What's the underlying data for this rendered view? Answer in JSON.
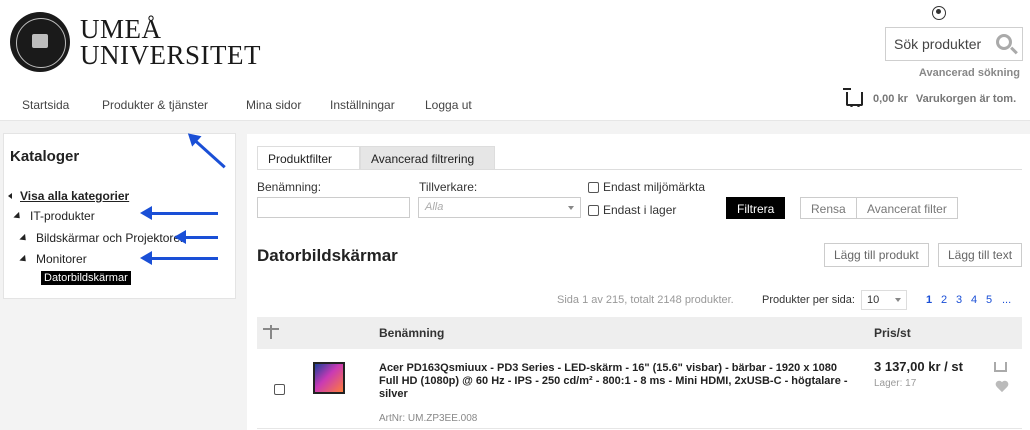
{
  "header": {
    "logo_line1": "UMEÅ",
    "logo_line2": "UNIVERSITET",
    "search_placeholder": "Sök produkter",
    "advanced_search": "Avancerad sökning",
    "cart_total": "0,00 kr",
    "cart_status": "Varukorgen är tom."
  },
  "nav": {
    "items": [
      "Startsida",
      "Produkter & tjänster",
      "Mina sidor",
      "Inställningar",
      "Logga ut"
    ]
  },
  "sidebar": {
    "title": "Kataloger",
    "show_all": "Visa alla kategorier",
    "items": [
      "IT-produkter",
      "Bildskärmar och Projektorer",
      "Monitorer",
      "Datorbildskärmar"
    ]
  },
  "filters": {
    "tabs": [
      "Produktfilter",
      "Avancerad filtrering"
    ],
    "name_label": "Benämning:",
    "name_value": "",
    "manufacturer_label": "Tillverkare:",
    "manufacturer_placeholder": "Alla",
    "eco_label": "Endast miljömärkta",
    "stock_label": "Endast i lager",
    "filter_button": "Filtrera",
    "clear_button": "Rensa",
    "advanced_button": "Avancerat filter"
  },
  "listing": {
    "title": "Datorbildskärmar",
    "add_product": "Lägg till produkt",
    "add_text": "Lägg till text",
    "paging_info": "Sida 1 av 215, totalt 2148 produkter.",
    "per_page_label": "Produkter per sida:",
    "per_page_value": "10",
    "pages": [
      "1",
      "2",
      "3",
      "4",
      "5",
      "..."
    ],
    "col_name": "Benämning",
    "col_price": "Pris/st"
  },
  "product": {
    "name": "Acer PD163Qsmiuux - PD3 Series - LED-skärm - 16\" (15.6\" visbar) - bärbar - 1920 x 1080 Full HD (1080p) @ 60 Hz - IPS - 250 cd/m² - 800:1 - 8 ms - Mini HDMI, 2xUSB-C - högtalare - silver",
    "artnr": "ArtNr: UM.ZP3EE.008",
    "price": "3 137,00 kr / st",
    "stock": "Lager: 17"
  },
  "colors": {
    "accent_blue": "#1a4fd6",
    "selected_bg": "#000000"
  }
}
